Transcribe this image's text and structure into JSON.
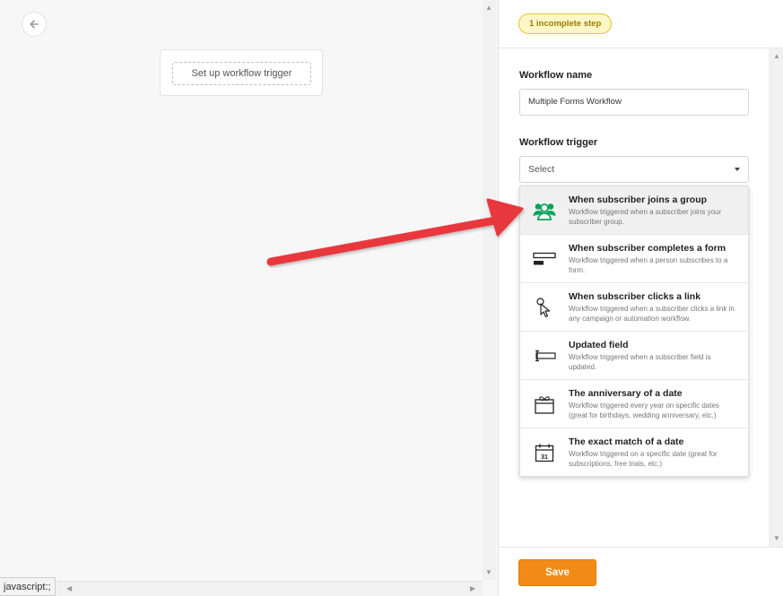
{
  "canvas": {
    "trigger_placeholder": "Set up workflow trigger"
  },
  "status_bar": {
    "url": "javascript:;"
  },
  "panel": {
    "badge": "1 incomplete step",
    "workflow_name_label": "Workflow name",
    "workflow_name_value": "Multiple Forms Workflow",
    "workflow_trigger_label": "Workflow trigger",
    "workflow_trigger_selected": "Select",
    "trigger_options": [
      {
        "icon": "group-icon",
        "title": "When subscriber joins a group",
        "description": "Workflow triggered when a subscriber joins your subscriber group."
      },
      {
        "icon": "form-icon",
        "title": "When subscriber completes a form",
        "description": "Workflow triggered when a person subscribes to a form."
      },
      {
        "icon": "cursor-click-icon",
        "title": "When subscriber clicks a link",
        "description": "Workflow triggered when a subscriber clicks a link in any campaign or automation workflow."
      },
      {
        "icon": "text-field-icon",
        "title": "Updated field",
        "description": "Workflow triggered when a subscriber field is updated."
      },
      {
        "icon": "gift-icon",
        "title": "The anniversary of a date",
        "description": "Workflow triggered every year on specific dates (great for birthdays, wedding anniversary, etc.)"
      },
      {
        "icon": "calendar-icon",
        "title": "The exact match of a date",
        "description": "Workflow triggered on a specific date (great for subscriptions, free trials, etc.)"
      }
    ],
    "calendar_day": "31",
    "save_label": "Save"
  },
  "colors": {
    "accent": "#f28a16",
    "badge_bg": "#fdf6c7",
    "badge_border": "#e3c52a",
    "group_icon": "#09a35a",
    "annotation_arrow": "#e8373c"
  }
}
